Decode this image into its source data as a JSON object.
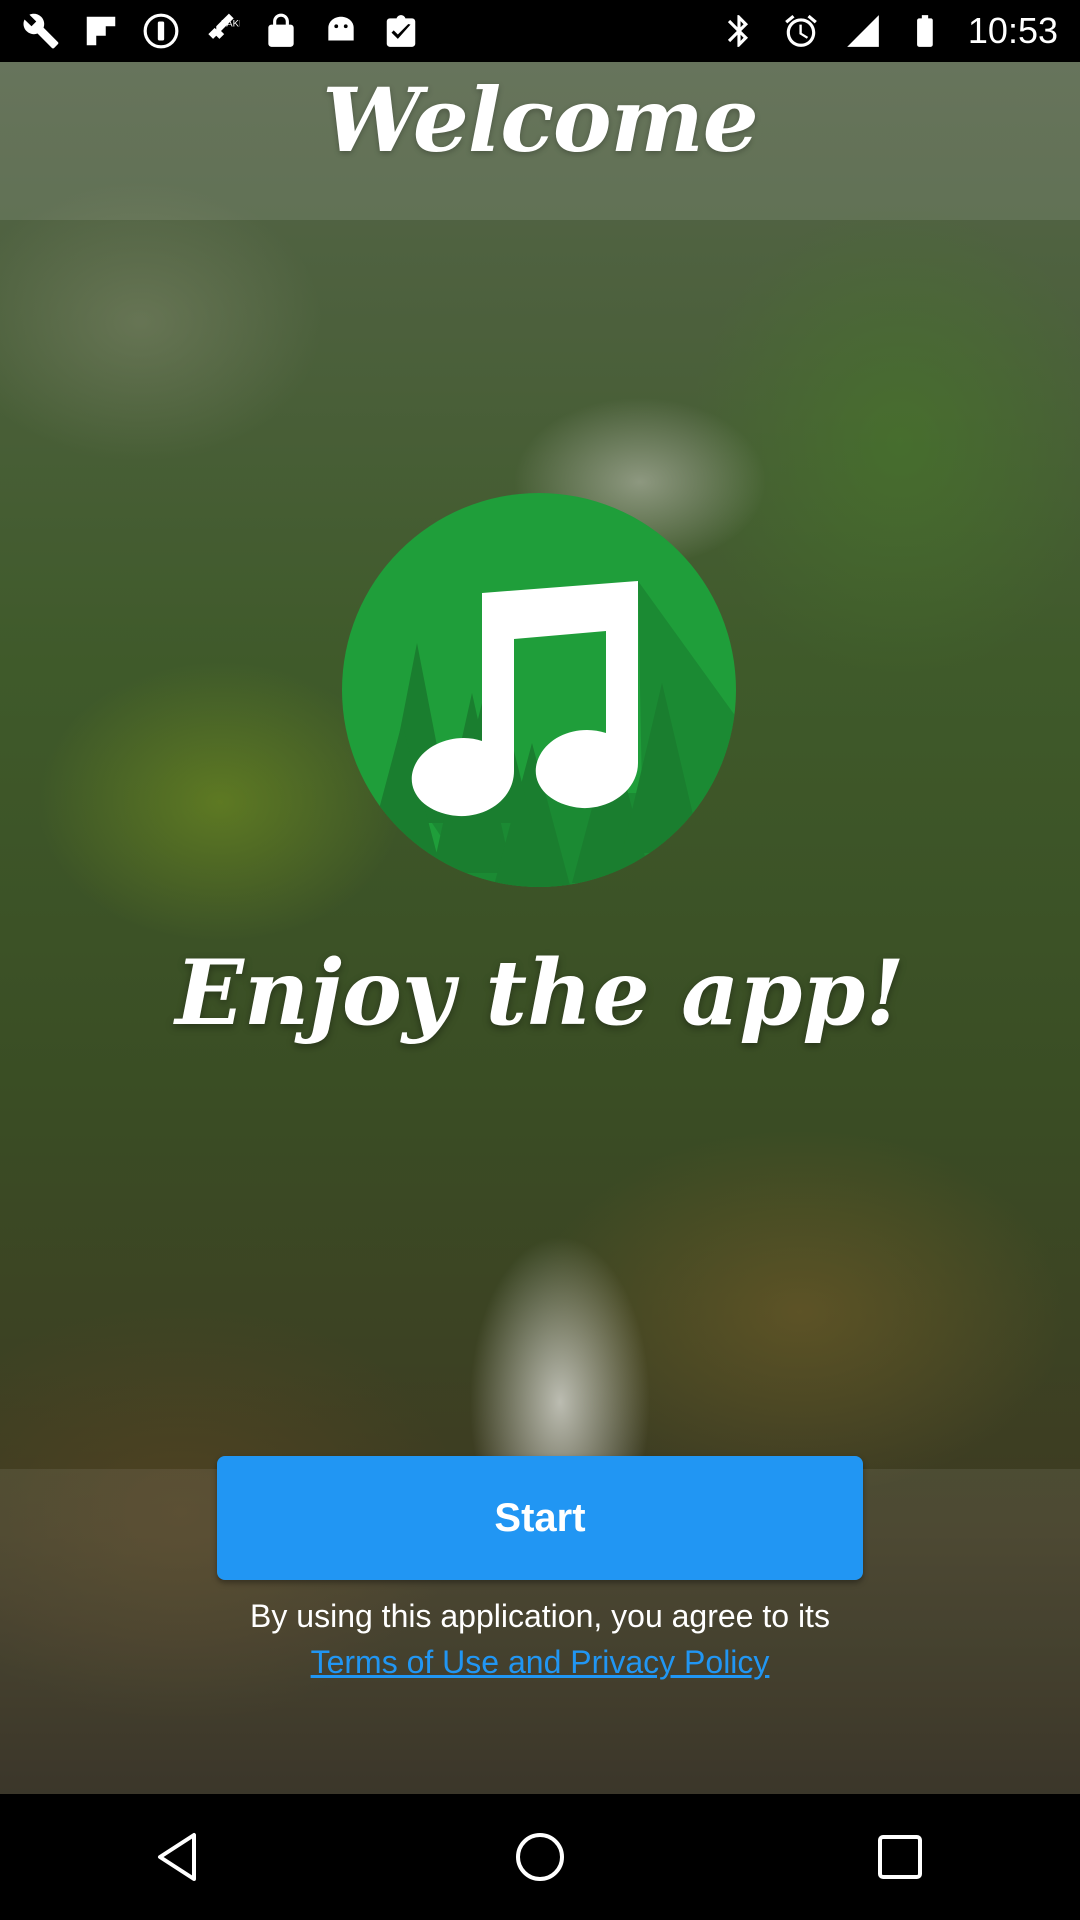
{
  "status_bar": {
    "time": "10:53",
    "left_icons": [
      "wrench-icon",
      "flipboard-icon",
      "alert-circle-icon",
      "fake-gps-icon",
      "lock-icon",
      "android-icon",
      "clipboard-check-icon"
    ],
    "right_icons": [
      "bluetooth-icon",
      "alarm-icon",
      "signal-icon",
      "battery-icon"
    ]
  },
  "header": {
    "title": "Welcome"
  },
  "main": {
    "logo_icon": "music-note-forest-icon",
    "tagline": "Enjoy the app!",
    "start_label": "Start",
    "consent_text": "By using this application, you agree to its",
    "terms_link": "Terms of Use and Privacy Policy"
  },
  "nav_bar": {
    "buttons": [
      "back-icon",
      "home-icon",
      "recents-icon"
    ]
  },
  "colors": {
    "accent": "#2196f3",
    "logo_green": "#1f9e3a",
    "logo_dark_green": "#1a7e2f"
  }
}
